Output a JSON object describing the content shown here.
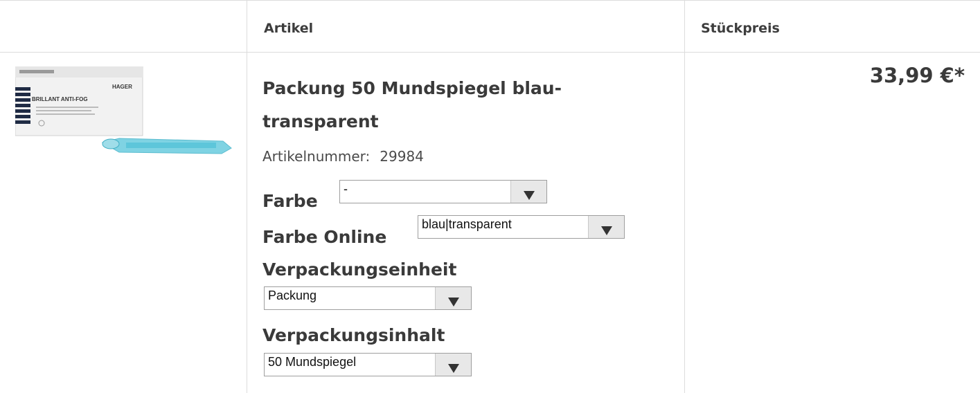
{
  "header": {
    "col_article": "Artikel",
    "col_unit_price": "Stückpreis"
  },
  "product": {
    "image_icon": "product-image",
    "title": "Packung 50 Mundspiegel blau-transparent",
    "article_number_label": "Artikelnummer:",
    "article_number": "29984",
    "price": "33,99 €*"
  },
  "options": {
    "farbe": {
      "label": "Farbe",
      "value": "-"
    },
    "farbe_online": {
      "label": "Farbe Online",
      "value": "blau|transparent"
    },
    "verpackungseinheit": {
      "label": "Verpackungseinheit",
      "value": "Packung"
    },
    "verpackungsinhalt": {
      "label": "Verpackungsinhalt",
      "value": "50 Mundspiegel"
    }
  }
}
